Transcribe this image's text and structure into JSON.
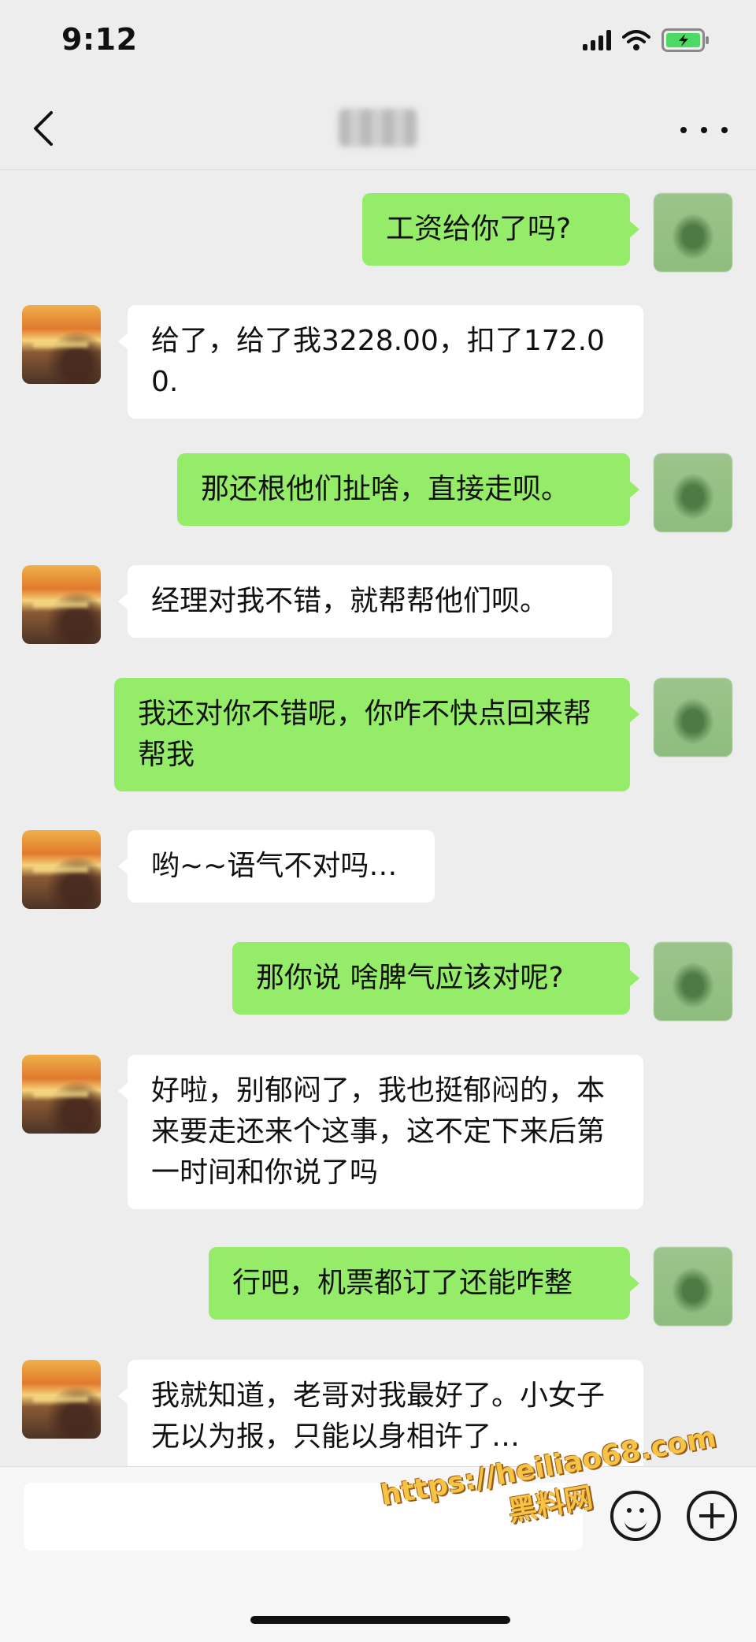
{
  "status_bar": {
    "time": "9:12"
  },
  "header": {
    "back_icon": "chevron-left-icon",
    "more_icon": "more-horizontal-icon"
  },
  "messages": [
    {
      "side": "right",
      "text": "工资给你了吗?"
    },
    {
      "side": "left",
      "text": "给了，给了我3228.00，扣了172.00."
    },
    {
      "side": "right",
      "text": "那还根他们扯啥，直接走呗。"
    },
    {
      "side": "left",
      "text": "经理对我不错，就帮帮他们呗。"
    },
    {
      "side": "right",
      "text": "我还对你不错呢，你咋不快点回来帮帮我"
    },
    {
      "side": "left",
      "text": "哟~~语气不对吗…"
    },
    {
      "side": "right",
      "text": "那你说 啥脾气应该对呢?"
    },
    {
      "side": "left",
      "text": "好啦，别郁闷了，我也挺郁闷的，本来要走还来个这事，这不定下来后第一时间和你说了吗"
    },
    {
      "side": "right",
      "text": "行吧，机票都订了还能咋整"
    },
    {
      "side": "left",
      "text": "我就知道，老哥对我最好了。小女子无以为报，只能以身相许了…"
    }
  ],
  "input_bar": {
    "emoji_icon": "emoji-icon",
    "plus_icon": "plus-icon"
  },
  "watermark": {
    "url": "https://heiliao68.com",
    "name": "黑料网"
  },
  "colors": {
    "background": "#ededed",
    "right_bubble": "#95ec69",
    "left_bubble": "#ffffff"
  }
}
